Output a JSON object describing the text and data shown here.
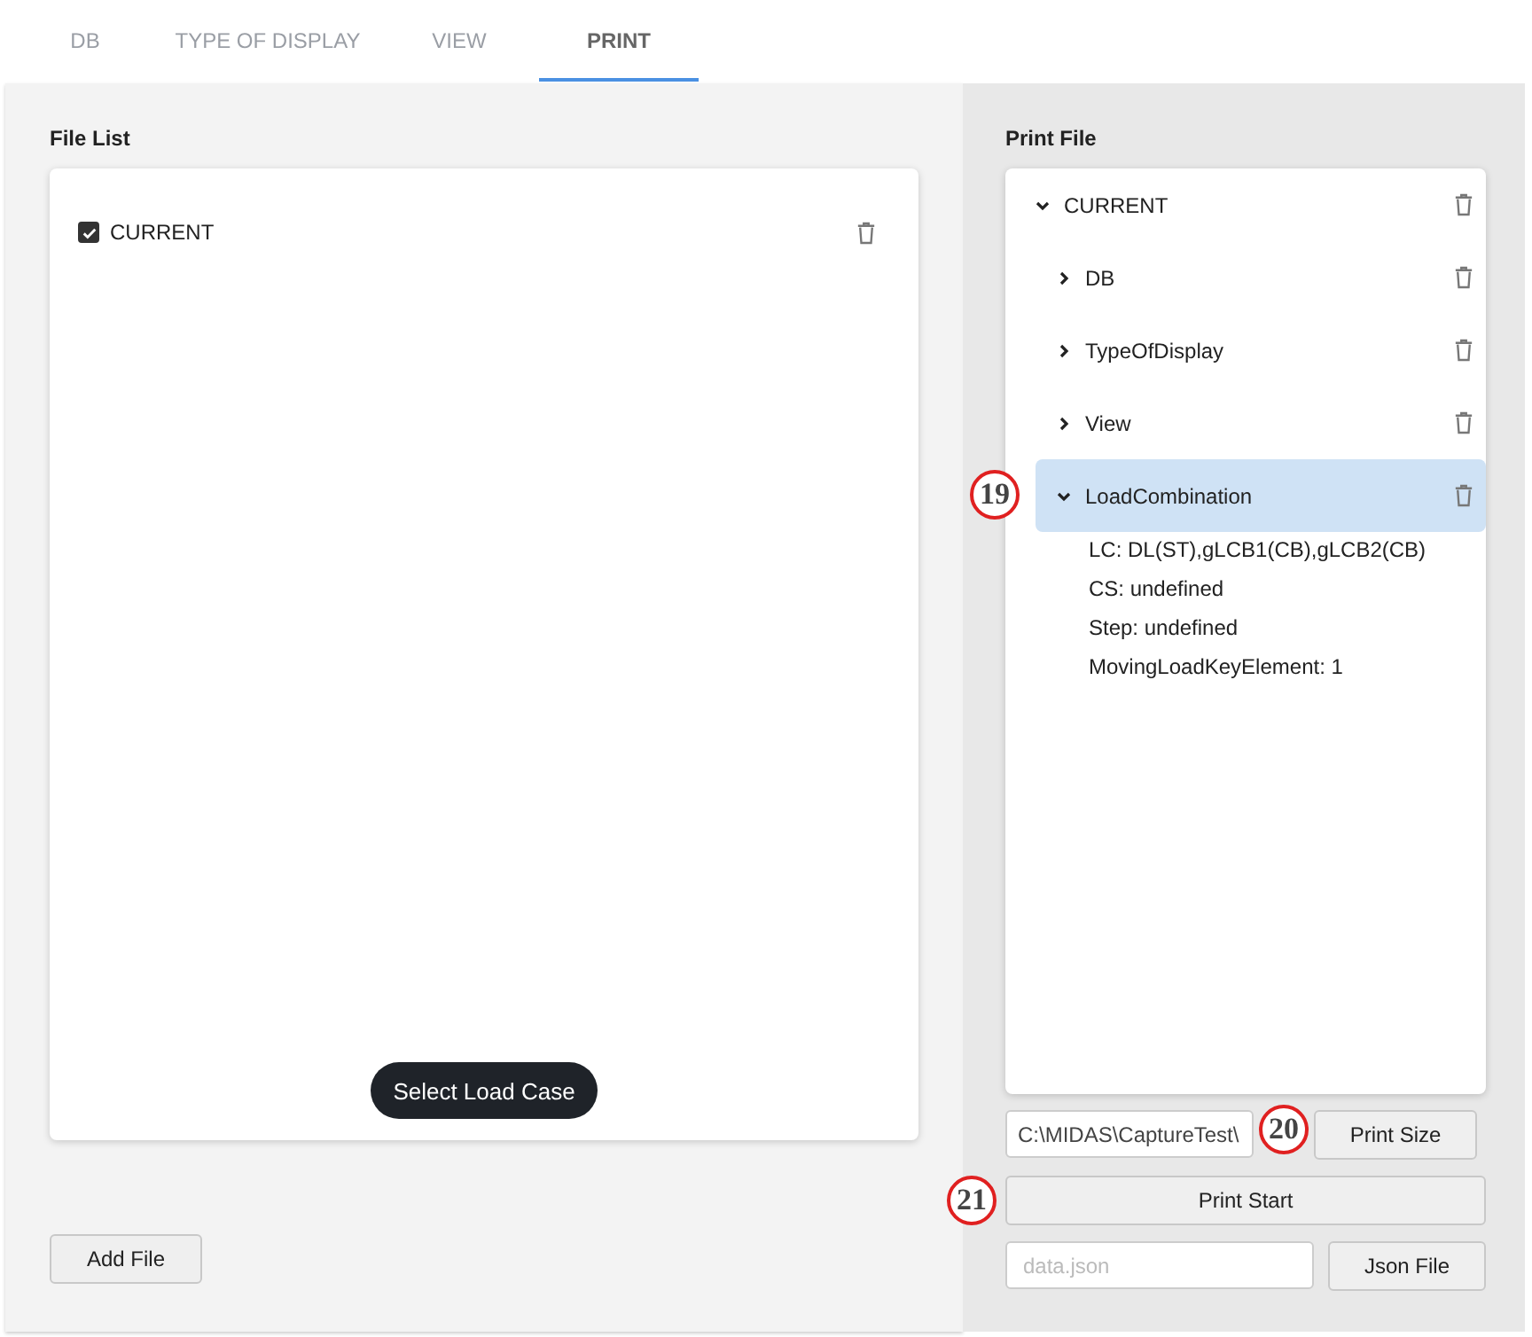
{
  "tabs": [
    {
      "label": "DB",
      "selected": false
    },
    {
      "label": "TYPE OF DISPLAY",
      "selected": false
    },
    {
      "label": "VIEW",
      "selected": false
    },
    {
      "label": "PRINT",
      "selected": true
    }
  ],
  "file_list": {
    "title": "File List",
    "items": [
      {
        "label": "CURRENT",
        "checked": true
      }
    ],
    "select_button": "Select Load Case",
    "add_button": "Add File"
  },
  "print_file": {
    "title": "Print File",
    "tree": [
      {
        "label": "CURRENT",
        "expanded": true,
        "selected": false,
        "children": [
          {
            "label": "DB",
            "expanded": false,
            "selected": false
          },
          {
            "label": "TypeOfDisplay",
            "expanded": false,
            "selected": false
          },
          {
            "label": "View",
            "expanded": false,
            "selected": false
          },
          {
            "label": "LoadCombination",
            "expanded": true,
            "selected": true,
            "callout": "19",
            "details": [
              "LC: DL(ST),gLCB1(CB),gLCB2(CB)",
              "CS: undefined",
              "Step: undefined",
              "MovingLoadKeyElement: 1"
            ]
          }
        ]
      }
    ],
    "path_field": {
      "value": "C:\\MIDAS\\CaptureTest\\",
      "callout": "20"
    },
    "print_size_button": "Print Size",
    "print_start_button": {
      "label": "Print Start",
      "callout": "21"
    },
    "json_field": {
      "placeholder": "data.json"
    },
    "json_button": "Json File"
  }
}
